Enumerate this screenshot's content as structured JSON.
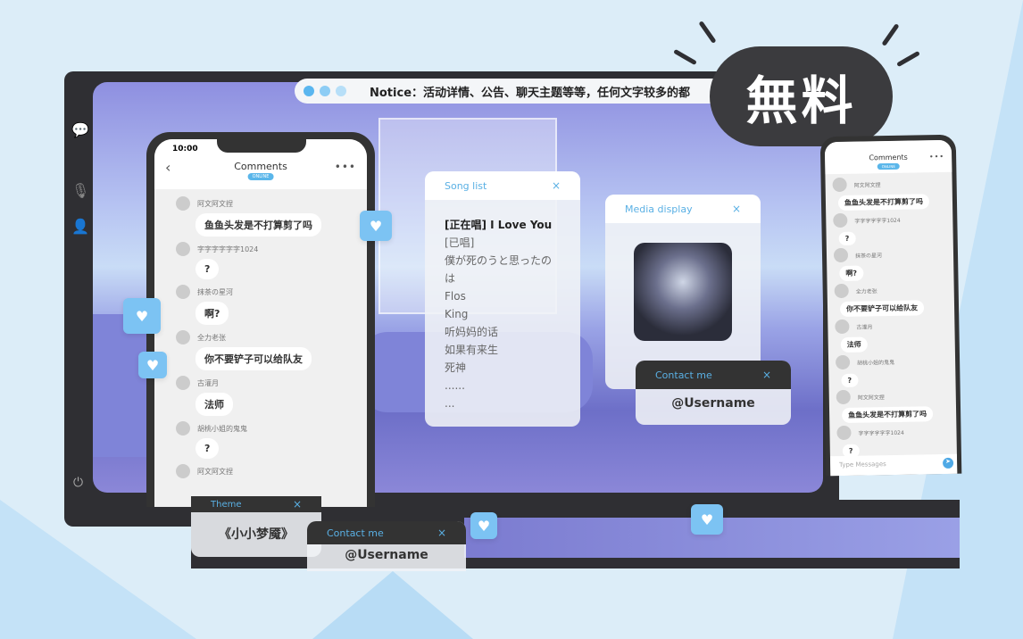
{
  "notice": {
    "text": "Notice：活动详情、公告、聊天主题等等，任何文字较多的都",
    "dots": [
      "#5ab6ef",
      "#8dcdf5",
      "#b7dff8"
    ]
  },
  "badge": {
    "text": "無料"
  },
  "phone": {
    "time": "10:00",
    "title": "Comments",
    "status": "ONLINE",
    "messages": [
      {
        "user": "阿文阿文捏",
        "text": "鱼鱼头发是不打算剪了吗"
      },
      {
        "user": "字字字字字字1024",
        "text": "?"
      },
      {
        "user": "抹茶の星河",
        "text": "啊?"
      },
      {
        "user": "全力老张",
        "text": "你不要铲子可以给队友"
      },
      {
        "user": "古灌月",
        "text": "法师"
      },
      {
        "user": "胡桃小姐的鬼鬼",
        "text": "?"
      },
      {
        "user": "阿文阿文捏",
        "text": ""
      }
    ]
  },
  "phone2": {
    "title": "Comments",
    "status": "ONLINE",
    "input_placeholder": "Type Messages",
    "messages": [
      {
        "user": "阿文阿文捏",
        "text": "鱼鱼头发是不打算剪了吗"
      },
      {
        "user": "字字字字字字1024",
        "text": "?"
      },
      {
        "user": "抹茶の星河",
        "text": "啊?"
      },
      {
        "user": "全力老张",
        "text": "你不要铲子可以给队友"
      },
      {
        "user": "古灌月",
        "text": "法师"
      },
      {
        "user": "胡桃小姐的鬼鬼",
        "text": "?"
      },
      {
        "user": "阿文阿文捏",
        "text": "鱼鱼头发是不打算剪了吗"
      },
      {
        "user": "字字字字字字1024",
        "text": "?"
      }
    ]
  },
  "song_list": {
    "title": "Song list",
    "items": [
      "[正在唱] I Love You",
      "[已唱]",
      "僕が死のうと思ったのは",
      "Flos",
      "King",
      "听妈妈的话",
      "如果有来生",
      "死神",
      "......",
      "..."
    ]
  },
  "media": {
    "title": "Media display"
  },
  "contact": {
    "title": "Contact me",
    "username": "@Username"
  },
  "theme": {
    "title": "Theme",
    "value": "《小小梦魇》"
  },
  "contact2": {
    "title": "Contact me",
    "username": "@Username"
  },
  "close": "×",
  "colors": {
    "accent": "#5ab0e4",
    "frame": "#2f2f33",
    "background": "#dcedf8"
  }
}
